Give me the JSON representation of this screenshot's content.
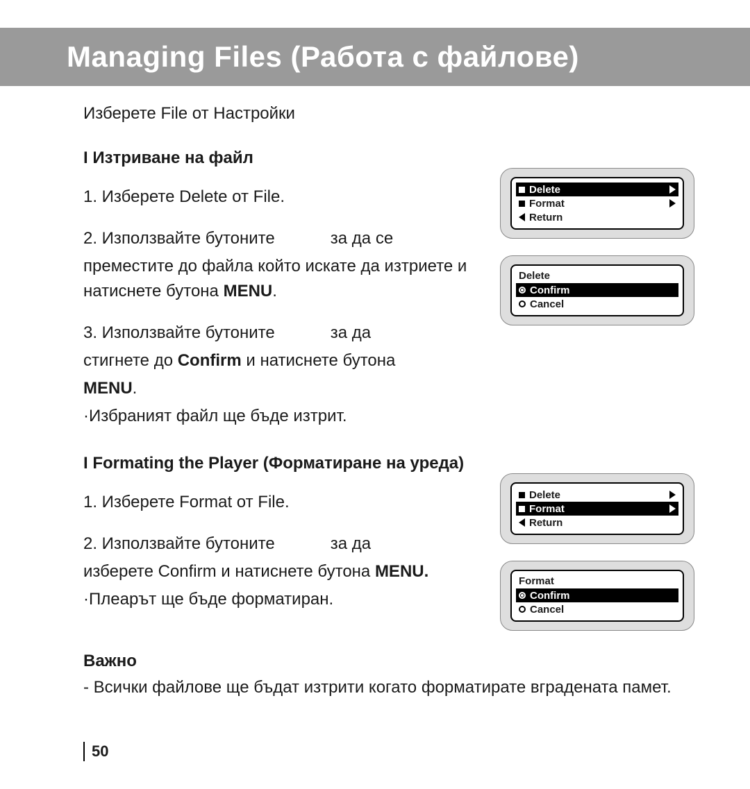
{
  "header": {
    "title": "Managing Files (Работа с файлове)"
  },
  "intro": "Изберете File от Настройки",
  "section_delete": {
    "marker": "I Изтриване на файл",
    "step1": "1. Изберете Delete от File.",
    "step2a": "2. Използвайте бутоните",
    "step2b": "за да се",
    "step2c": "преместите до файла който искате да изтриете и натиснете бутона ",
    "menu": "MENU",
    "step3a": "3. Използвайте бутоните",
    "step3b": "за да",
    "step3c": "стигнете до ",
    "confirm": "Confirm",
    "step3d": " и натиснете бутона ",
    "dot": ".",
    "note": "·Избраният файл ще бъде изтрит."
  },
  "section_format": {
    "marker": "I Formating the Player  (Форматиране на уреда)",
    "step1": "1. Изберете Format от File.",
    "step2a": "2. Използвайте бутоните",
    "step2b": "за да",
    "step2c": "изберете Confirm и натиснете бутона ",
    "menu": "MENU.",
    "note": "·Плеарът ще бъде форматиран."
  },
  "important": {
    "label": "Важно",
    "text": "- Всички файлове ще бъдат изтрити когато форматирате вградената памет."
  },
  "footer": {
    "page_number": "50"
  },
  "screens": {
    "file_menu_delete_selected": {
      "items": [
        {
          "label": "Delete",
          "selected": true,
          "arrow": "right"
        },
        {
          "label": "Format",
          "selected": false,
          "arrow": "right"
        },
        {
          "label": "Return",
          "selected": false,
          "arrow": "left"
        }
      ]
    },
    "delete_confirm": {
      "title": "Delete",
      "items": [
        {
          "label": "Confirm",
          "selected": true
        },
        {
          "label": "Cancel",
          "selected": false
        }
      ]
    },
    "file_menu_format_selected": {
      "items": [
        {
          "label": "Delete",
          "selected": false,
          "arrow": "right"
        },
        {
          "label": "Format",
          "selected": true,
          "arrow": "right"
        },
        {
          "label": "Return",
          "selected": false,
          "arrow": "left"
        }
      ]
    },
    "format_confirm": {
      "title": "Format",
      "items": [
        {
          "label": "Confirm",
          "selected": true
        },
        {
          "label": "Cancel",
          "selected": false
        }
      ]
    }
  }
}
